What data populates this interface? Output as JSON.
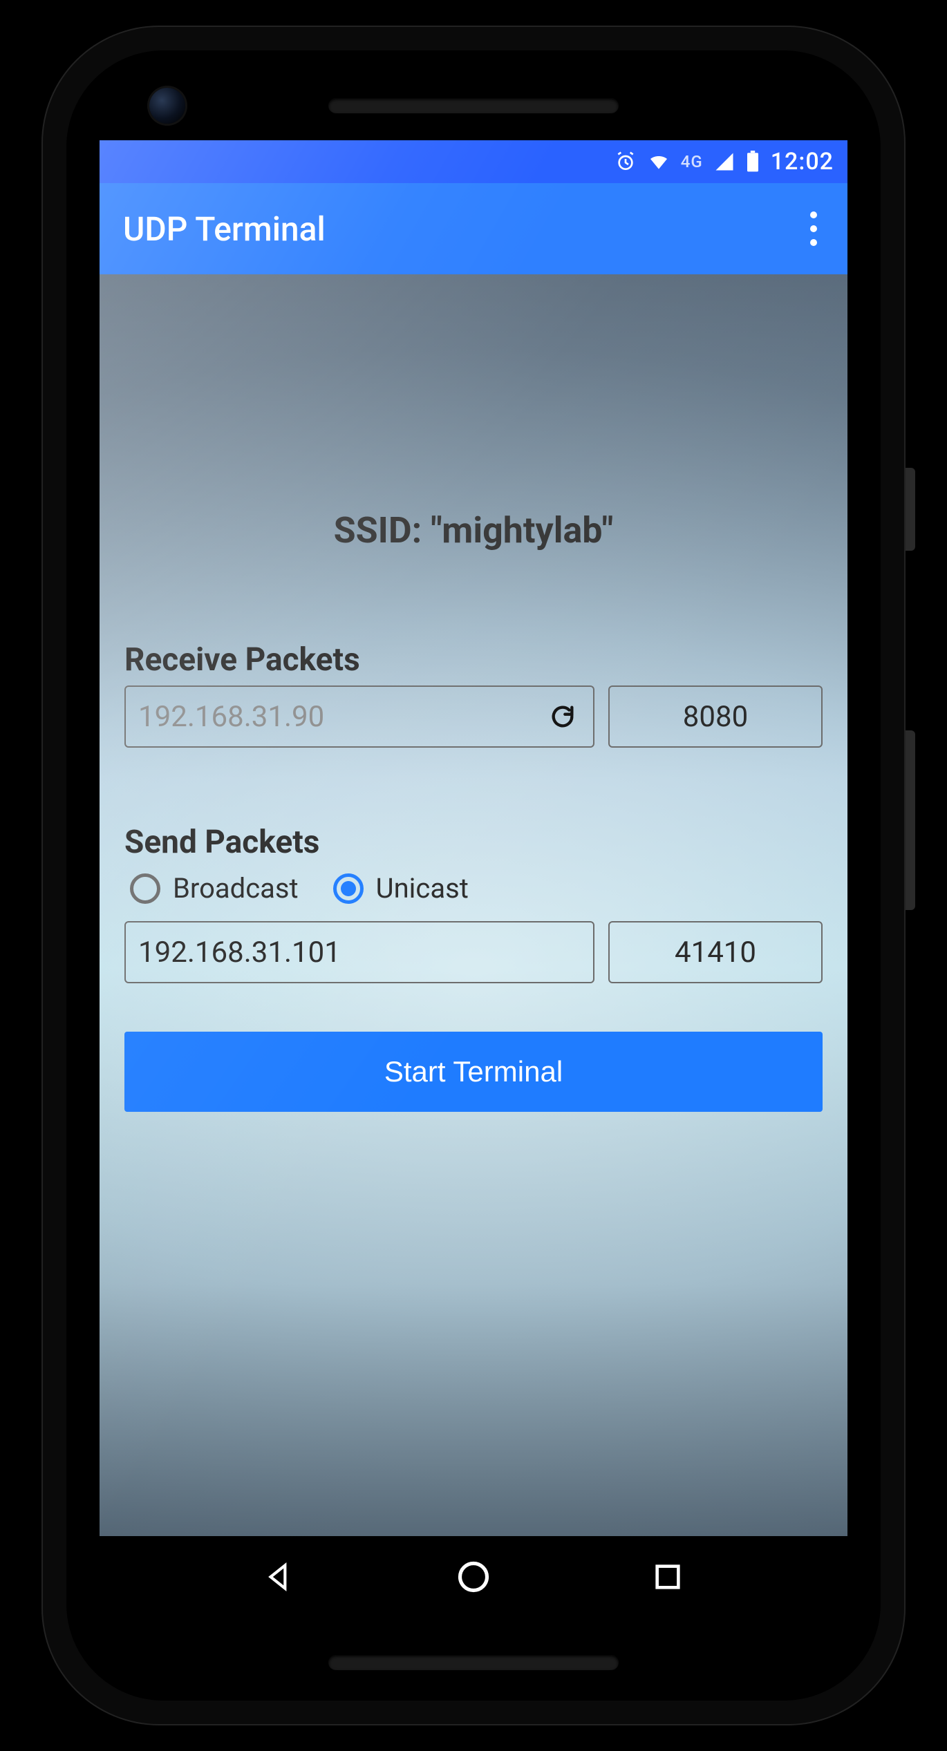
{
  "status": {
    "time": "12:02",
    "network_label": "4G"
  },
  "app": {
    "title": "UDP Terminal"
  },
  "ssid": {
    "label": "SSID: \"mightylab\""
  },
  "receive": {
    "section_label": "Receive Packets",
    "ip": "192.168.31.90",
    "port": "8080"
  },
  "send": {
    "section_label": "Send Packets",
    "modes": {
      "broadcast_label": "Broadcast",
      "unicast_label": "Unicast",
      "selected": "unicast"
    },
    "ip": "192.168.31.101",
    "port": "41410"
  },
  "action": {
    "start_label": "Start Terminal"
  }
}
